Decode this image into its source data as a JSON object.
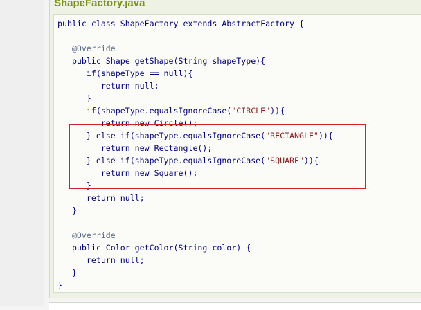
{
  "file": {
    "title": "ShapeFactory.java"
  },
  "code": {
    "lines": [
      "public class ShapeFactory extends AbstractFactory {",
      "",
      "   @Override",
      "   public Shape getShape(String shapeType){",
      "      if(shapeType == null){",
      "         return null;",
      "      }",
      "      if(shapeType.equalsIgnoreCase(\"CIRCLE\")){",
      "         return new Circle();",
      "      } else if(shapeType.equalsIgnoreCase(\"RECTANGLE\")){",
      "         return new Rectangle();",
      "      } else if(shapeType.equalsIgnoreCase(\"SQUARE\")){",
      "         return new Square();",
      "      }",
      "      return null;",
      "   }",
      "",
      "   @Override",
      "   public Color getColor(String color) {",
      "      return null;",
      "   }",
      "}"
    ]
  },
  "colors": {
    "keyword": "#000080",
    "annotation": "#5a6d86",
    "string": "#8b1d1d",
    "title": "#7a9117",
    "highlight_border": "#d1202a"
  }
}
